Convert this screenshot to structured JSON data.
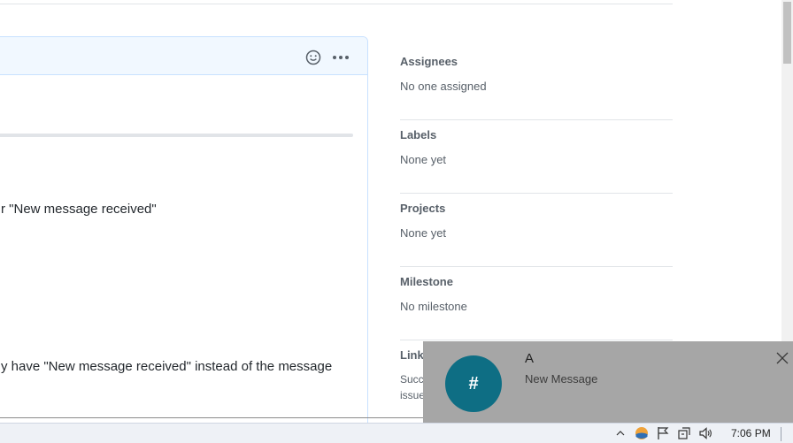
{
  "comment": {
    "lines": [
      "r \"New message received\"",
      "y have \"New message received\" instead of the message"
    ]
  },
  "sidebar": {
    "sections": [
      {
        "heading": "Assignees",
        "value": "No one assigned"
      },
      {
        "heading": "Labels",
        "value": "None yet"
      },
      {
        "heading": "Projects",
        "value": "None yet"
      },
      {
        "heading": "Milestone",
        "value": "No milestone"
      },
      {
        "heading": "Linked",
        "value": "Successfully merging a pull request may close this issue."
      }
    ],
    "linked_visible": {
      "heading": "Linke",
      "line1": "Succ",
      "line2": "issue"
    }
  },
  "notification": {
    "avatar_glyph": "#",
    "title": "A",
    "body": "New Message",
    "accent_color": "#0e6e84"
  },
  "taskbar": {
    "clock": "7:06 PM",
    "tray_icons": [
      "chevron-up-icon",
      "weather-icon",
      "flag-icon",
      "network-icon",
      "volume-icon"
    ]
  }
}
